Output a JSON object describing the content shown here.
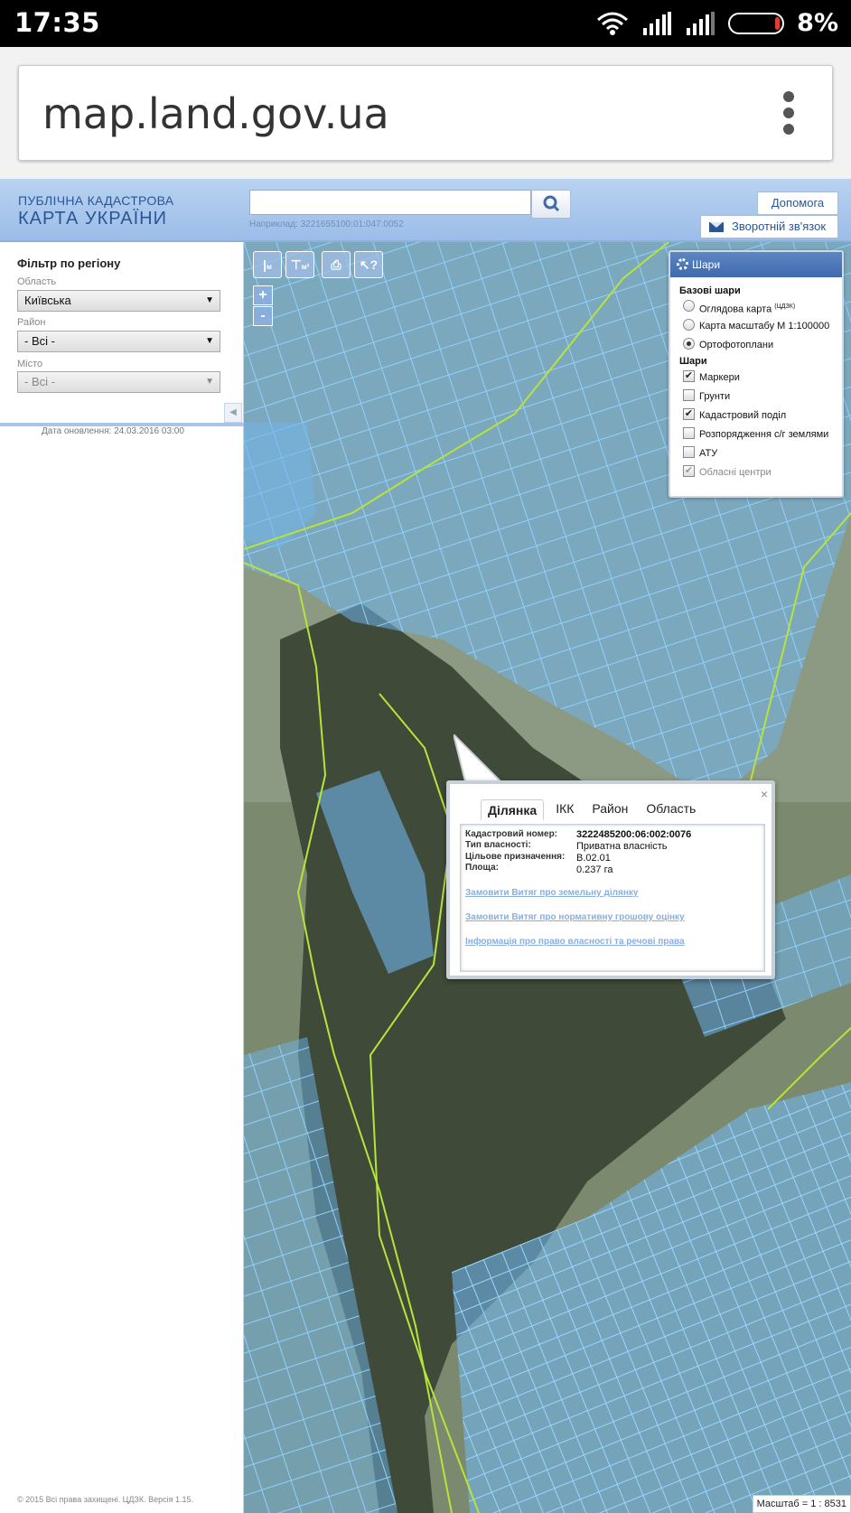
{
  "status_bar": {
    "time": "17:35",
    "battery": "8%"
  },
  "browser": {
    "url": "map.land.gov.ua"
  },
  "header": {
    "logo_line1": "ПУБЛІЧНА КАДАСТРОВА",
    "logo_line2": "КАРТА УКРАЇНИ",
    "search_placeholder": "",
    "search_hint": "Наприклад: 3221655100:01:047:0052",
    "help_label": "Допомога",
    "feedback_label": "Зворотній зв'язок"
  },
  "filter": {
    "title": "Фільтр по регіону",
    "oblast_label": "Область",
    "oblast_value": "Київська",
    "rayon_label": "Район",
    "rayon_value": "- Всі -",
    "city_label": "Місто",
    "city_value": "- Всі -",
    "update_date": "Дата оновлення: 24.03.2016 03:00",
    "copyright": "© 2015 Всі права захищені. ЦДЗК. Версія 1.15."
  },
  "map_tools": {
    "measure_length": "м",
    "measure_area": "м²",
    "zoom_in": "+",
    "zoom_out": "-"
  },
  "layers_panel": {
    "title": "Шари",
    "base_title": "Базові шари",
    "base": [
      {
        "label": "Оглядова карта",
        "sup": "(ЦДЗК)",
        "selected": false
      },
      {
        "label": "Карта масштабу М 1:100000",
        "selected": false
      },
      {
        "label": "Ортофотоплани",
        "selected": true
      }
    ],
    "layers_title": "Шари",
    "layers": [
      {
        "label": "Маркери",
        "checked": true,
        "disabled": false
      },
      {
        "label": "Грунти",
        "checked": false,
        "disabled": false
      },
      {
        "label": "Кадастровий поділ",
        "checked": true,
        "disabled": false
      },
      {
        "label": "Розпорядження с/г землями",
        "checked": false,
        "disabled": false
      },
      {
        "label": "АТУ",
        "checked": false,
        "disabled": false
      },
      {
        "label": "Обласні центри",
        "checked": true,
        "disabled": true
      }
    ]
  },
  "popup": {
    "tabs": [
      "Ділянка",
      "ІКК",
      "Район",
      "Область"
    ],
    "active_tab": "Ділянка",
    "fields": [
      {
        "label": "Кадастровий номер:",
        "value": "3222485200:06:002:0076",
        "bold": true
      },
      {
        "label": "Тип власності:",
        "value": "Приватна власність",
        "bold": false
      },
      {
        "label": "Цільове призначення:",
        "value": "В.02.01",
        "bold": false
      },
      {
        "label": "Площа:",
        "value": "0.237 га",
        "bold": false
      }
    ],
    "links": [
      "Замовити Витяг про земельну ділянку",
      "Замовити Витяг про нормативну грошову оцінку",
      "Інформація про право власності та речові права"
    ],
    "close": "×"
  },
  "scale": "Масштаб = 1 : 8531",
  "colors": {
    "accent": "#2a5693",
    "parcel_fill": "#6fb4ec",
    "parcel_stroke": "#8fd0ff",
    "boundary": "#b7e43a"
  }
}
